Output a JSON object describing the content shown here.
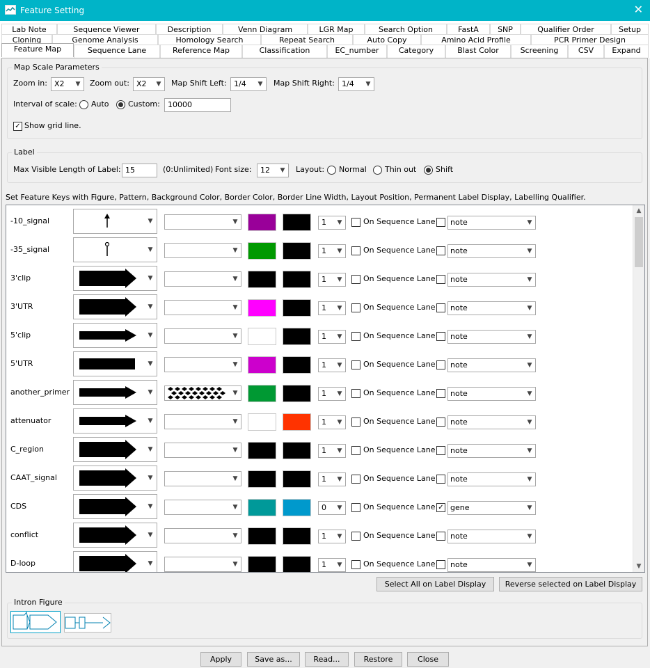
{
  "window": {
    "title": "Feature Setting"
  },
  "tabs_row1": [
    "Lab Note",
    "Sequence Viewer",
    "Description",
    "Venn Diagram",
    "LGR Map",
    "Search Option",
    "FastA",
    "SNP",
    "Qualifier Order",
    "Setup"
  ],
  "tabs_row2": [
    "Cloning",
    "Genome Analysis",
    "Homology Search",
    "Repeat Search",
    "Auto Copy",
    "Amino Acid Profile",
    "PCR Primer Design"
  ],
  "tabs_row3": [
    "Feature Map",
    "Sequence Lane",
    "Reference Map",
    "Classification",
    "EC_number",
    "Category",
    "Blast Color",
    "Screening",
    "CSV",
    "Expand"
  ],
  "map_scale": {
    "legend": "Map Scale Parameters",
    "zoom_in_label": "Zoom in:",
    "zoom_in_value": "X2",
    "zoom_out_label": "Zoom out:",
    "zoom_out_value": "X2",
    "shift_left_label": "Map Shift Left:",
    "shift_left_value": "1/4",
    "shift_right_label": "Map Shift Right:",
    "shift_right_value": "1/4",
    "interval_label": "Interval of scale:",
    "auto_label": "Auto",
    "custom_label": "Custom:",
    "custom_value": "10000",
    "grid_label": "Show grid line."
  },
  "label": {
    "legend": "Label",
    "max_length_label": "Max Visible Length of Label:",
    "max_length_value": "15",
    "unlimited_hint": "(0:Unlimited)",
    "font_size_label": "Font size:",
    "font_size_value": "12",
    "layout_label": "Layout:",
    "layout_normal": "Normal",
    "layout_thin": "Thin out",
    "layout_shift": "Shift"
  },
  "instructions": "Set Feature Keys with Figure, Pattern, Background Color, Border Color, Border Line Width, Layout Position, Permanent Label Display, Labelling Qualifier.",
  "lane_label": "On Sequence Lane",
  "features": [
    {
      "key": "-10_signal",
      "figure": "up-arrow",
      "pattern": "",
      "bg": "#990099",
      "border": "#000000",
      "width": "1",
      "lane": false,
      "perm": false,
      "qualifier": "note"
    },
    {
      "key": "-35_signal",
      "figure": "pin",
      "pattern": "",
      "bg": "#009900",
      "border": "#000000",
      "width": "1",
      "lane": false,
      "perm": false,
      "qualifier": "note"
    },
    {
      "key": "3'clip",
      "figure": "thick-arrow",
      "pattern": "",
      "bg": "#000000",
      "border": "#000000",
      "width": "1",
      "lane": false,
      "perm": false,
      "qualifier": "note"
    },
    {
      "key": "3'UTR",
      "figure": "thick-arrow",
      "pattern": "",
      "bg": "#ff00ff",
      "border": "#000000",
      "width": "1",
      "lane": false,
      "perm": false,
      "qualifier": "note"
    },
    {
      "key": "5'clip",
      "figure": "thin-arrow",
      "pattern": "",
      "bg": "#ffffff",
      "border": "#000000",
      "width": "1",
      "lane": false,
      "perm": false,
      "qualifier": "note"
    },
    {
      "key": "5'UTR",
      "figure": "box",
      "pattern": "",
      "bg": "#cc00cc",
      "border": "#000000",
      "width": "1",
      "lane": false,
      "perm": false,
      "qualifier": "note"
    },
    {
      "key": "another_primer",
      "figure": "thin-arrow",
      "pattern": "diamonds",
      "bg": "#009933",
      "border": "#000000",
      "width": "1",
      "lane": false,
      "perm": false,
      "qualifier": "note"
    },
    {
      "key": "attenuator",
      "figure": "thin-arrow",
      "pattern": "",
      "bg": "#ffffff",
      "border": "#ff3300",
      "width": "1",
      "lane": false,
      "perm": false,
      "qualifier": "note"
    },
    {
      "key": "C_region",
      "figure": "thick-arrow",
      "pattern": "",
      "bg": "#000000",
      "border": "#000000",
      "width": "1",
      "lane": false,
      "perm": false,
      "qualifier": "note"
    },
    {
      "key": "CAAT_signal",
      "figure": "thick-arrow",
      "pattern": "",
      "bg": "#000000",
      "border": "#000000",
      "width": "1",
      "lane": false,
      "perm": false,
      "qualifier": "note"
    },
    {
      "key": "CDS",
      "figure": "thick-arrow",
      "pattern": "",
      "bg": "#009999",
      "border": "#0099cc",
      "width": "0",
      "lane": false,
      "perm": true,
      "qualifier": "gene"
    },
    {
      "key": "conflict",
      "figure": "thick-arrow",
      "pattern": "",
      "bg": "#000000",
      "border": "#000000",
      "width": "1",
      "lane": false,
      "perm": false,
      "qualifier": "note"
    },
    {
      "key": "D-loop",
      "figure": "thick-arrow",
      "pattern": "",
      "bg": "#000000",
      "border": "#000000",
      "width": "1",
      "lane": false,
      "perm": false,
      "qualifier": "note"
    }
  ],
  "buttons": {
    "select_all": "Select All on Label Display",
    "reverse": "Reverse selected on Label Display",
    "apply": "Apply",
    "save_as": "Save as...",
    "read": "Read...",
    "restore": "Restore",
    "close": "Close"
  },
  "intron": {
    "legend": "Intron Figure"
  }
}
